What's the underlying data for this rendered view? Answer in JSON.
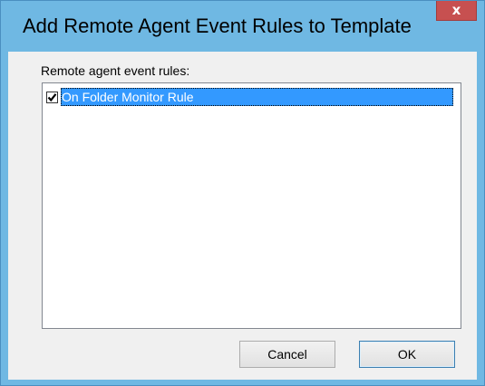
{
  "dialog": {
    "title": "Add Remote Agent Event Rules to Template",
    "close_label": "x"
  },
  "rules_list": {
    "label": "Remote agent event rules:",
    "items": [
      {
        "label": "On Folder Monitor Rule",
        "checked": true,
        "selected": true
      }
    ]
  },
  "buttons": {
    "cancel_label": "Cancel",
    "ok_label": "OK"
  },
  "colors": {
    "window_frame": "#6fb8e3",
    "close_button": "#c75050",
    "selection": "#3399ff",
    "client_bg": "#f0f0f0"
  },
  "icons": {
    "close": "close-icon",
    "check": "checkmark-icon"
  }
}
